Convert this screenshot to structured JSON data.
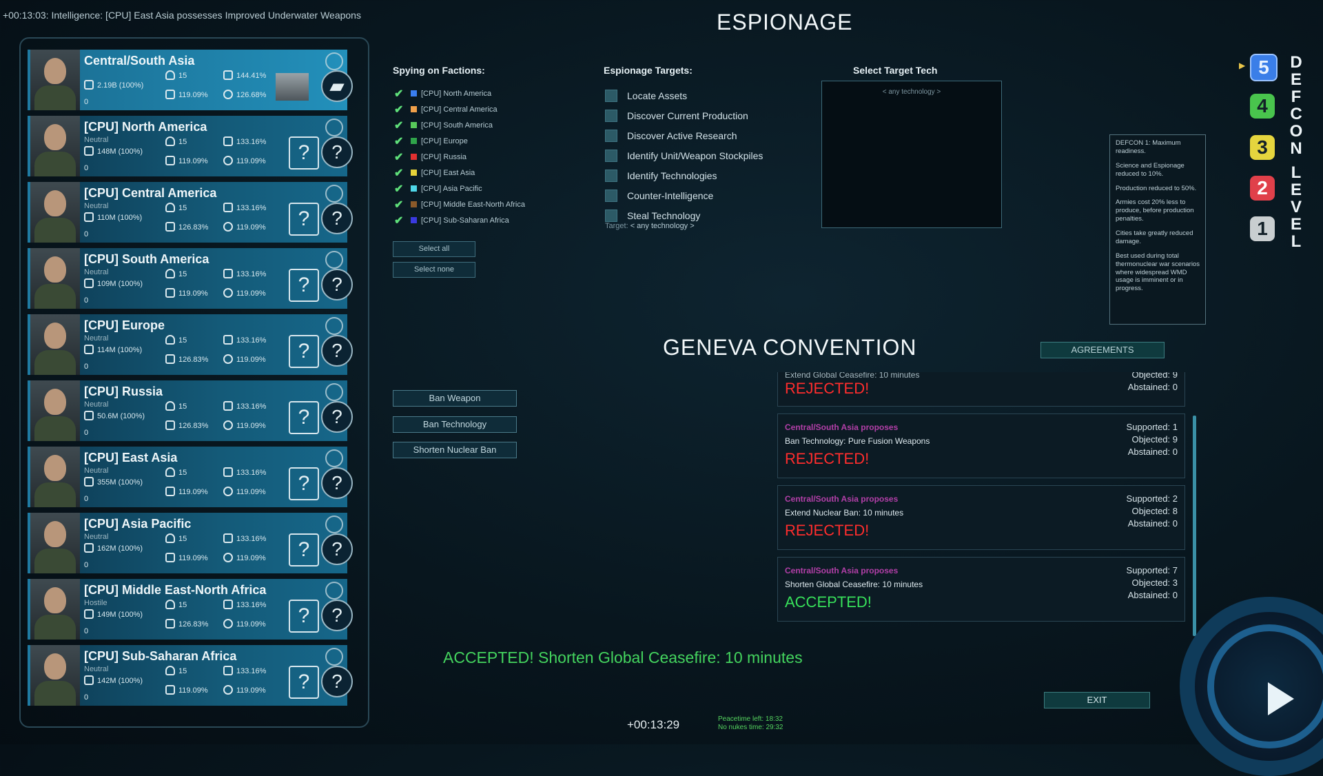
{
  "ticker": "+00:13:03: Intelligence: [CPU] East Asia possesses Improved Underwater Weapons",
  "factions": [
    {
      "name": "Central/South Asia",
      "status": "",
      "pop": "2.19B (100%)",
      "zero": "0",
      "agents": "15",
      "production": "119.09%",
      "military": "144.41%",
      "science": "126.68%",
      "active": true
    },
    {
      "name": "[CPU] North America",
      "status": "Neutral",
      "pop": "148M (100%)",
      "zero": "0",
      "agents": "15",
      "production": "119.09%",
      "military": "133.16%",
      "science": "119.09%",
      "active": false
    },
    {
      "name": "[CPU] Central America",
      "status": "Neutral",
      "pop": "110M (100%)",
      "zero": "0",
      "agents": "15",
      "production": "126.83%",
      "military": "133.16%",
      "science": "119.09%",
      "active": false
    },
    {
      "name": "[CPU] South America",
      "status": "Neutral",
      "pop": "109M (100%)",
      "zero": "0",
      "agents": "15",
      "production": "119.09%",
      "military": "133.16%",
      "science": "119.09%",
      "active": false
    },
    {
      "name": "[CPU] Europe",
      "status": "Neutral",
      "pop": "114M (100%)",
      "zero": "0",
      "agents": "15",
      "production": "126.83%",
      "military": "133.16%",
      "science": "119.09%",
      "active": false
    },
    {
      "name": "[CPU] Russia",
      "status": "Neutral",
      "pop": "50.6M (100%)",
      "zero": "0",
      "agents": "15",
      "production": "126.83%",
      "military": "133.16%",
      "science": "119.09%",
      "active": false
    },
    {
      "name": "[CPU] East Asia",
      "status": "Neutral",
      "pop": "355M (100%)",
      "zero": "0",
      "agents": "15",
      "production": "119.09%",
      "military": "133.16%",
      "science": "119.09%",
      "active": false
    },
    {
      "name": "[CPU] Asia Pacific",
      "status": "Neutral",
      "pop": "162M (100%)",
      "zero": "0",
      "agents": "15",
      "production": "119.09%",
      "military": "133.16%",
      "science": "119.09%",
      "active": false
    },
    {
      "name": "[CPU] Middle East-North Africa",
      "status": "Hostile",
      "pop": "149M (100%)",
      "zero": "0",
      "agents": "15",
      "production": "126.83%",
      "military": "133.16%",
      "science": "119.09%",
      "active": false
    },
    {
      "name": "[CPU] Sub-Saharan Africa",
      "status": "Neutral",
      "pop": "142M (100%)",
      "zero": "0",
      "agents": "15",
      "production": "119.09%",
      "military": "133.16%",
      "science": "119.09%",
      "active": false
    }
  ],
  "espionage": {
    "title": "ESPIONAGE",
    "spying_header": "Spying on Factions:",
    "spying": [
      {
        "label": "[CPU] North America",
        "color": "#3a7ef0"
      },
      {
        "label": "[CPU] Central America",
        "color": "#f0a04a"
      },
      {
        "label": "[CPU] South America",
        "color": "#58c85a"
      },
      {
        "label": "[CPU] Europe",
        "color": "#2fa44a"
      },
      {
        "label": "[CPU] Russia",
        "color": "#e03030"
      },
      {
        "label": "[CPU] East Asia",
        "color": "#e6d23a"
      },
      {
        "label": "[CPU] Asia Pacific",
        "color": "#4fd6e8"
      },
      {
        "label": "[CPU] Middle East-North Africa",
        "color": "#8a5a2a"
      },
      {
        "label": "[CPU] Sub-Saharan Africa",
        "color": "#3a3ae0"
      }
    ],
    "select_all": "Select all",
    "select_none": "Select none",
    "targets_header": "Espionage Targets:",
    "targets": [
      "Locate Assets",
      "Discover Current Production",
      "Discover Active Research",
      "Identify Unit/Weapon Stockpiles",
      "Identify Technologies",
      "Counter-Intelligence",
      "Steal Technology"
    ],
    "target_prefix": "Target:",
    "target_value": "< any technology >",
    "tech_header": "Select Target Tech",
    "tech_placeholder": "< any technology >"
  },
  "defcon": {
    "levels": [
      "5",
      "4",
      "3",
      "2",
      "1"
    ],
    "word1": [
      "D",
      "E",
      "F",
      "C",
      "O",
      "N"
    ],
    "word2": [
      "L",
      "E",
      "V",
      "E",
      "L"
    ],
    "current": "5",
    "colors": {
      "5": "#3a7ee8",
      "4": "#49c44d",
      "3": "#e5d53e",
      "2": "#e0404a",
      "1": "#c9ced0"
    },
    "tooltip": [
      "DEFCON 1: Maximum readiness.",
      "Science and Espionage reduced to 10%.",
      "Production reduced to 50%.",
      "Armies cost 20% less to produce, before production penalties.",
      "Cities take greatly reduced damage.",
      "Best used during total thermonuclear war scenarios where widespread WMD usage is imminent or in progress."
    ]
  },
  "geneva": {
    "title": "GENEVA CONVENTION",
    "agreements_label": "AGREEMENTS",
    "buttons": {
      "ban_weapon": "Ban Weapon",
      "ban_technology": "Ban Technology",
      "shorten_nuclear_ban": "Shorten Nuclear Ban"
    },
    "partial": {
      "what": "Extend Global Ceasefire: 10 minutes",
      "result": "REJECTED!",
      "objected": "Objected: 9",
      "abstained": "Abstained: 0"
    },
    "proposals": [
      {
        "who": "Central/South Asia proposes",
        "what": "Ban Technology: Pure Fusion Weapons",
        "result": "REJECTED!",
        "accepted": false,
        "supported": "Supported: 1",
        "objected": "Objected: 9",
        "abstained": "Abstained: 0"
      },
      {
        "who": "Central/South Asia proposes",
        "what": "Extend Nuclear Ban: 10 minutes",
        "result": "REJECTED!",
        "accepted": false,
        "supported": "Supported: 2",
        "objected": "Objected: 8",
        "abstained": "Abstained: 0"
      },
      {
        "who": "Central/South Asia proposes",
        "what": "Shorten Global Ceasefire: 10 minutes",
        "result": "ACCEPTED!",
        "accepted": true,
        "supported": "Supported: 7",
        "objected": "Objected: 3",
        "abstained": "Abstained: 0"
      }
    ],
    "announcement": "ACCEPTED! Shorten Global Ceasefire: 10 minutes"
  },
  "footer": {
    "exit_label": "EXIT",
    "game_time": "+00:13:29",
    "peacetime_left": "Peacetime left: 18:32",
    "no_nukes_time": "No nukes time: 29:32"
  }
}
